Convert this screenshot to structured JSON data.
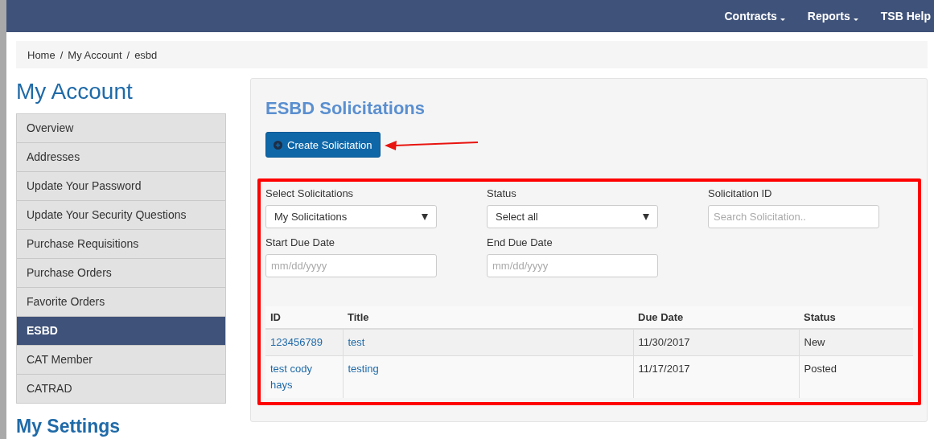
{
  "nav": {
    "items": [
      {
        "label": "Contracts",
        "dropdown": true
      },
      {
        "label": "Reports",
        "dropdown": true
      },
      {
        "label": "TSB Help",
        "dropdown": false
      }
    ]
  },
  "breadcrumb": {
    "separator": "/",
    "items": [
      "Home",
      "My Account",
      "esbd"
    ]
  },
  "sidebar": {
    "title": "My Account",
    "items": [
      {
        "label": "Overview",
        "selected": false
      },
      {
        "label": "Addresses",
        "selected": false
      },
      {
        "label": "Update Your Password",
        "selected": false
      },
      {
        "label": "Update Your Security Questions",
        "selected": false
      },
      {
        "label": "Purchase Requisitions",
        "selected": false
      },
      {
        "label": "Purchase Orders",
        "selected": false
      },
      {
        "label": "Favorite Orders",
        "selected": false
      },
      {
        "label": "ESBD",
        "selected": true
      },
      {
        "label": "CAT Member",
        "selected": false
      },
      {
        "label": "CATRAD",
        "selected": false
      }
    ],
    "settings_title": "My Settings"
  },
  "panel": {
    "title": "ESBD Solicitations",
    "create_button": "Create Solicitation",
    "filters": [
      {
        "kind": "select",
        "label": "Select Solicitations",
        "value": "My Solicitations"
      },
      {
        "kind": "select",
        "label": "Status",
        "value": "Select all"
      },
      {
        "kind": "input",
        "label": "Solicitation ID",
        "placeholder": "Search Solicitation.."
      },
      {
        "kind": "input",
        "label": "Start Due Date",
        "placeholder": "mm/dd/yyyy"
      },
      {
        "kind": "input",
        "label": "End Due Date",
        "placeholder": "mm/dd/yyyy"
      }
    ],
    "table": {
      "columns": [
        "ID",
        "Title",
        "Due Date",
        "Status"
      ],
      "rows": [
        [
          "123456789",
          "test",
          "11/30/2017",
          "New"
        ],
        [
          "test cody hays",
          "testing",
          "11/17/2017",
          "Posted"
        ]
      ]
    }
  }
}
